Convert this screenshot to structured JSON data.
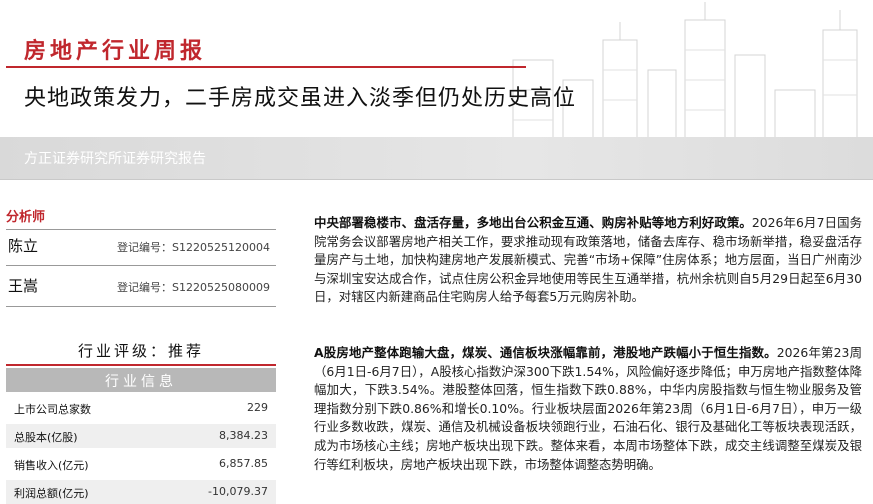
{
  "header": {
    "report_title": "房地产行业周报",
    "headline": "央地政策发力，二手房成交虽进入淡季但仍处历史高位",
    "institution": "方正证券研究所证券研究报告"
  },
  "analysts": {
    "heading": "分析师",
    "list": [
      {
        "name": "陈立",
        "reg": "登记编号：S1220525120004"
      },
      {
        "name": "王嵩",
        "reg": "登记编号：S1220525080009"
      }
    ]
  },
  "rating": {
    "label": "行业评级：推荐"
  },
  "industry_info": {
    "heading": "行业信息",
    "rows": [
      {
        "key": "上市公司总家数",
        "value": "229"
      },
      {
        "key": "总股本(亿股)",
        "value": "8,384.23"
      },
      {
        "key": "销售收入(亿元)",
        "value": "6,857.85"
      },
      {
        "key": "利润总额(亿元)",
        "value": "-10,079.37"
      }
    ]
  },
  "body": {
    "p1_bold": "中央部署稳楼市、盘活存量，多地出台公积金互通、购房补贴等地方利好政策。",
    "p1_text": "2026年6月7日国务院常务会议部署房地产相关工作，要求推动现有政策落地，储备去库存、稳市场新举措，稳妥盘活存量房产与土地，加快构建房地产发展新模式、完善“市场+保障”住房体系；地方层面，当日广州南沙与深圳宝安达成合作，试点住房公积金异地使用等民生互通举措，杭州余杭则自5月29日起至6月30日，对辖区内新建商品住宅购房人给予每套5万元购房补助。",
    "p2_bold": "A股房地产整体跑输大盘，煤炭、通信板块涨幅靠前，港股地产跌幅小于恒生指数。",
    "p2_text": "2026年第23周（6月1日-6月7日），A股核心指数沪深300下跌1.54%，风险偏好逐步降低；申万房地产指数整体降幅加大，下跌3.54%。港股整体回落，恒生指数下跌0.88%，中华内房股指数与恒生物业服务及管理指数分别下跌0.86%和增长0.10%。行业板块层面2026年第23周（6月1日-6月7日），申万一级行业多数收跌，煤炭、通信及机械设备板块领跑行业，石油石化、银行及基础化工等板块表现活跃，成为市场核心主线；房地产板块出现下跌。整体来看，本周市场整体下跌，成交主线调整至煤炭及银行等红利板块，房地产板块出现下跌，市场整体调整态势明确。"
  }
}
